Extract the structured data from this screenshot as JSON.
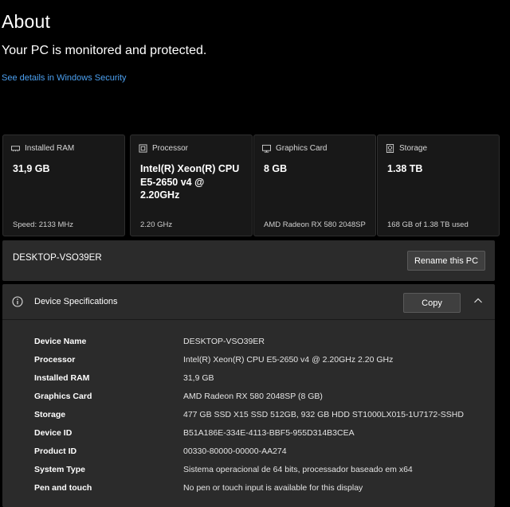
{
  "header": {
    "title": "About",
    "subtitle": "Your PC is monitored and protected.",
    "security_link": "See details in Windows Security"
  },
  "cards": [
    {
      "label": "Installed RAM",
      "icon": "ram-icon",
      "value": "31,9 GB",
      "detail": "Speed: 2133 MHz"
    },
    {
      "label": "Processor",
      "icon": "processor-icon",
      "value": "Intel(R) Xeon(R) CPU E5-2650 v4 @ 2.20GHz",
      "detail": "2.20 GHz"
    },
    {
      "label": "Graphics Card",
      "icon": "graphics-card-icon",
      "value": "8 GB",
      "detail": "AMD Radeon RX 580 2048SP"
    },
    {
      "label": "Storage",
      "icon": "storage-icon",
      "value": "1.38 TB",
      "detail": "168 GB of 1.38 TB used"
    }
  ],
  "pc_name": {
    "name": "DESKTOP-VSO39ER",
    "rename_label": "Rename this PC"
  },
  "device_specs": {
    "title": "Device Specifications",
    "copy_label": "Copy",
    "rows": [
      {
        "key": "Device Name",
        "value": "DESKTOP-VSO39ER"
      },
      {
        "key": "Processor",
        "value": "Intel(R) Xeon(R) CPU E5-2650 v4 @ 2.20GHz   2.20 GHz"
      },
      {
        "key": "Installed RAM",
        "value": "31,9 GB"
      },
      {
        "key": "Graphics Card",
        "value": "AMD Radeon RX 580 2048SP (8 GB)"
      },
      {
        "key": "Storage",
        "value": "477 GB SSD X15  SSD  512GB, 932 GB HDD ST1000LX015-1U7172-SSHD"
      },
      {
        "key": "Device ID",
        "value": "B51A186E-334E-4113-BBF5-955D314B3CEA"
      },
      {
        "key": "Product ID",
        "value": "00330-80000-00000-AA274"
      },
      {
        "key": "System Type",
        "value": "Sistema operacional de 64 bits, processador baseado em x64"
      },
      {
        "key": "Pen and touch",
        "value": "No pen or touch input is available for this display"
      }
    ]
  },
  "colors": {
    "background": "#000000",
    "card": "#181818",
    "panel": "#2b2b2b",
    "link": "#4ca0f0"
  }
}
